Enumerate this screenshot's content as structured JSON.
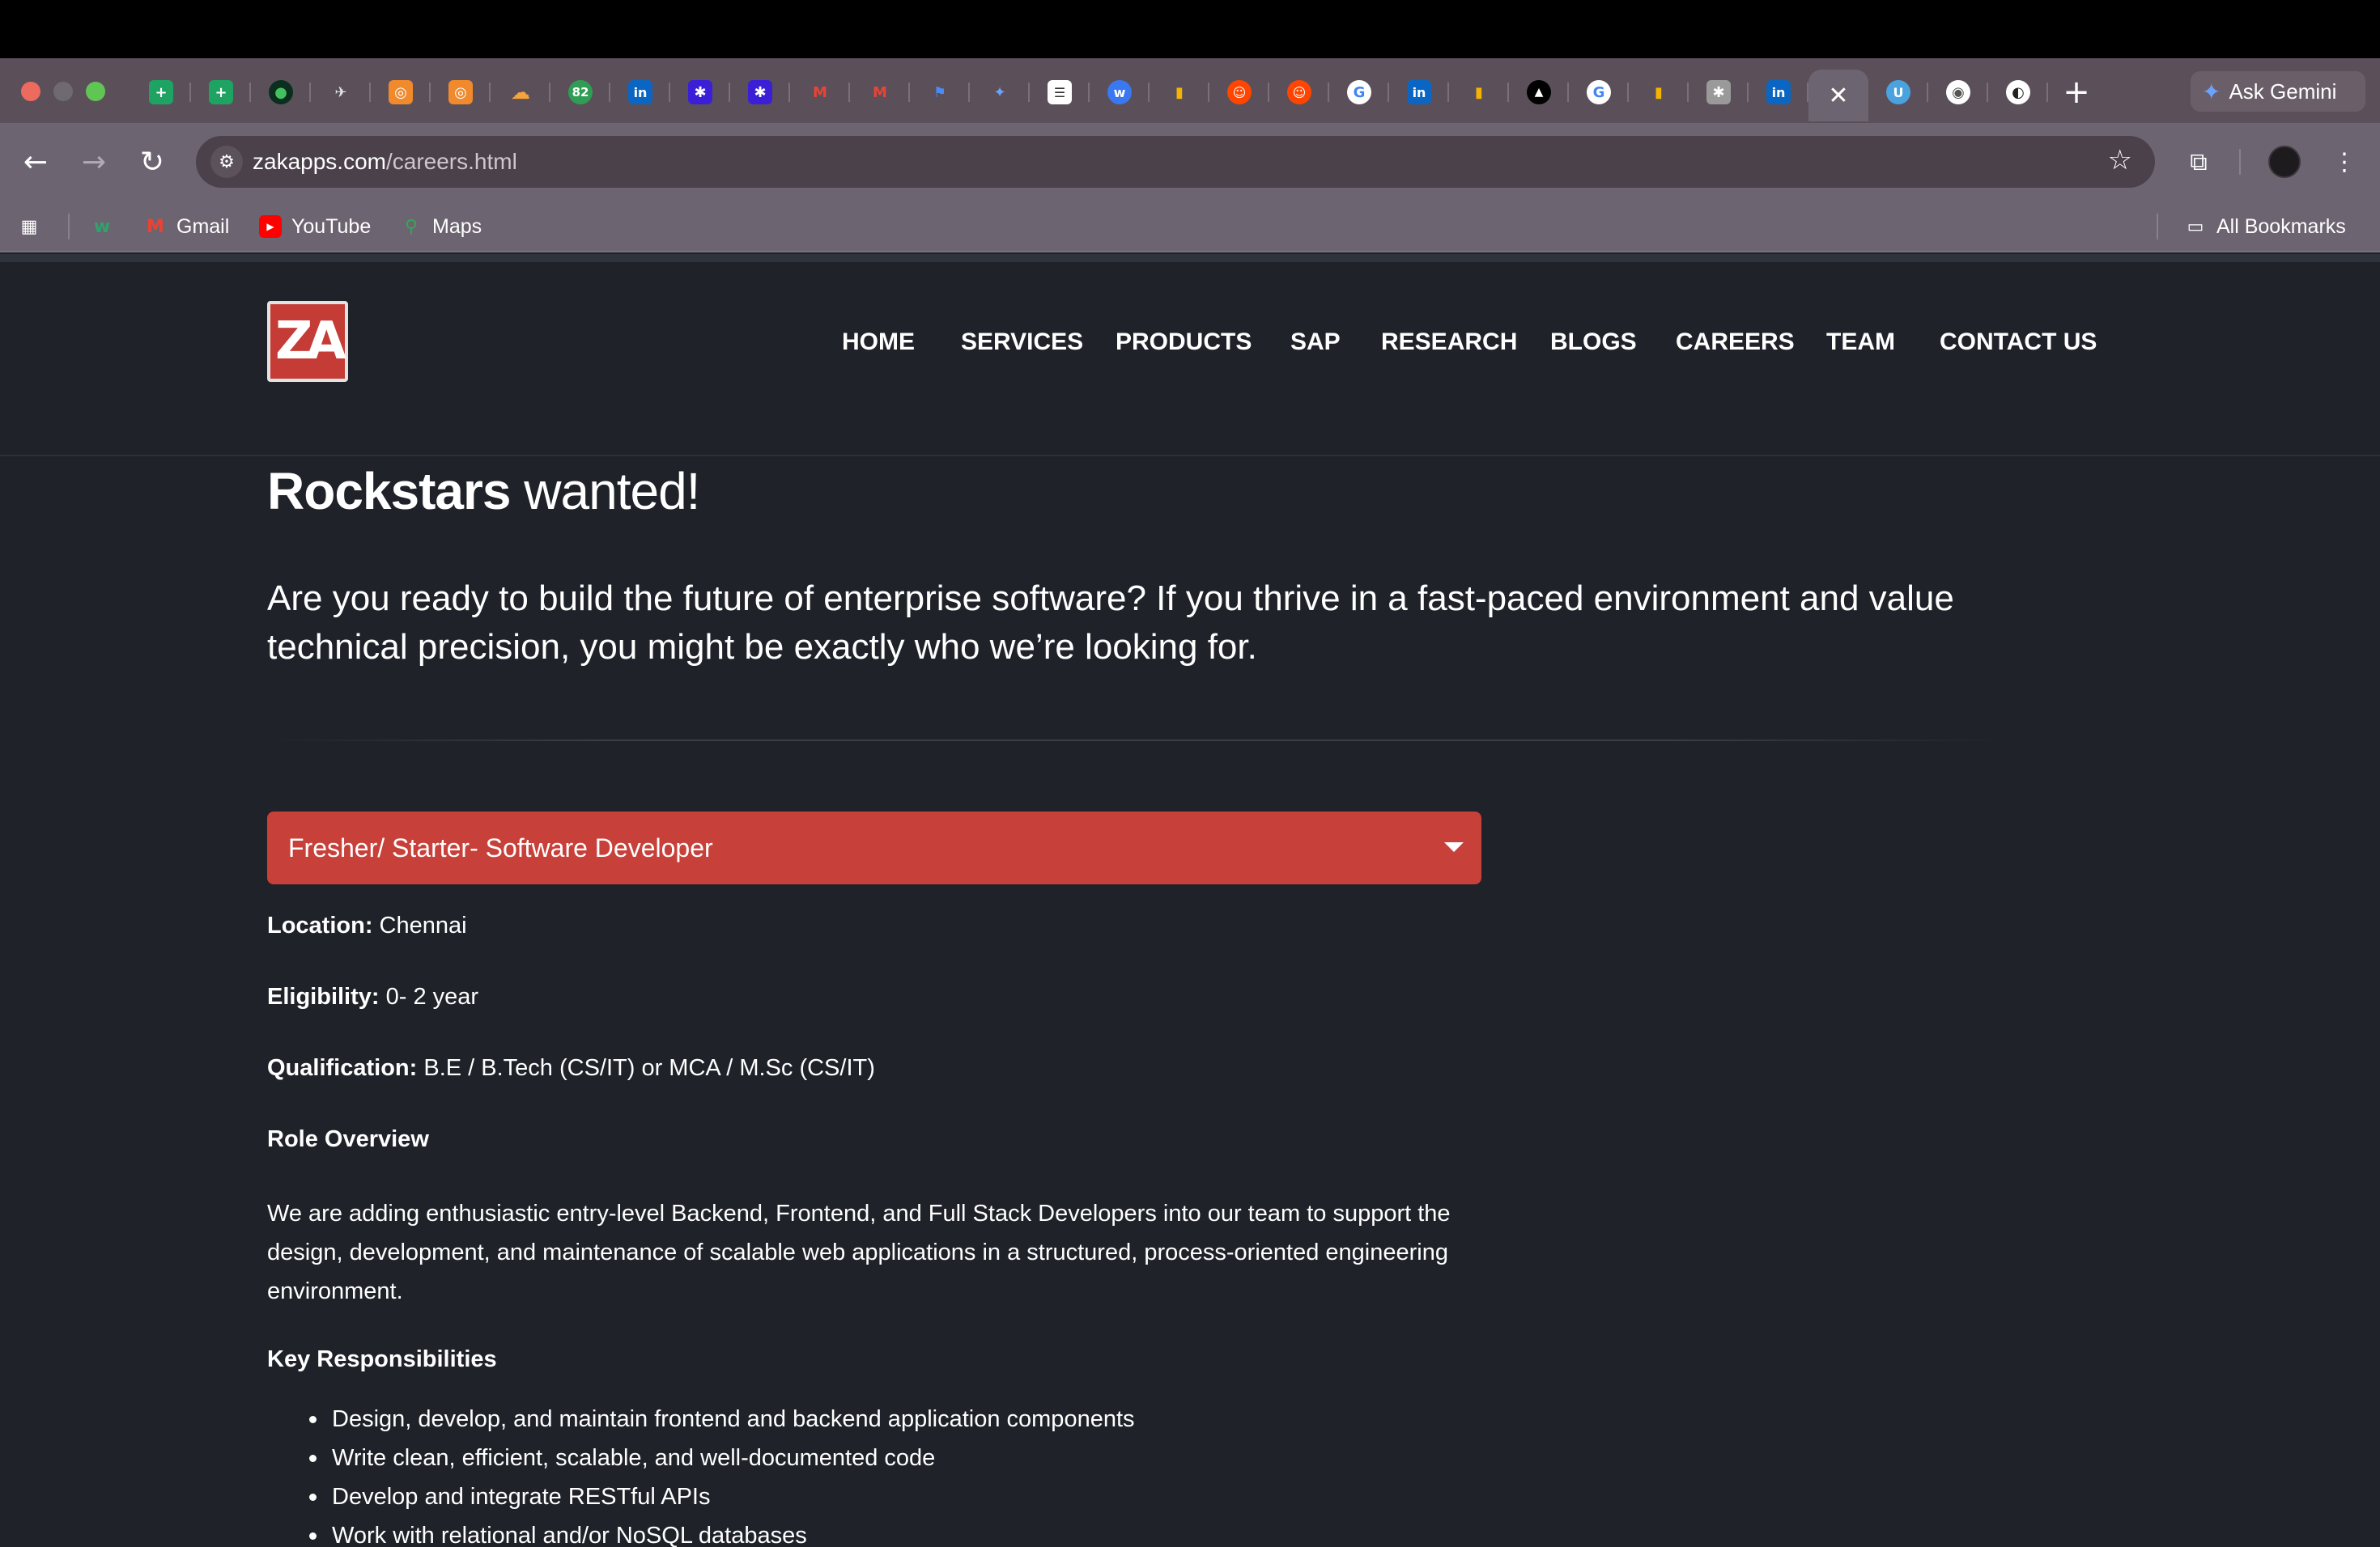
{
  "browser": {
    "tabs_icons": [
      "sheets-icon",
      "sheets-icon",
      "mongodb-icon",
      "bird-icon",
      "orange-app-icon",
      "orange-app-icon",
      "cloudflare-icon",
      "badge-82-icon",
      "linkedin-icon",
      "slack-icon",
      "slack-icon",
      "gmail-icon",
      "gmail-icon",
      "flag-icon",
      "gemini-icon",
      "document-icon",
      "webflow-icon",
      "analytics-icon",
      "reddit-icon",
      "reddit-icon",
      "google-icon",
      "linkedin-icon",
      "analytics-icon",
      "vercel-icon",
      "google-icon",
      "analytics-icon",
      "puzzle-icon",
      "linkedin-icon"
    ],
    "badge_count": "82",
    "ask_gemini": "Ask Gemini",
    "url_host": "zakapps.com",
    "url_path": "/careers.html",
    "bookmarks": {
      "gmail": "Gmail",
      "youtube": "YouTube",
      "maps": "Maps",
      "all": "All Bookmarks"
    }
  },
  "site": {
    "logo_text": "ZA",
    "nav": [
      "HOME",
      "SERVICES",
      "PRODUCTS",
      "SAP",
      "RESEARCH",
      "BLOGS",
      "CAREERS",
      "TEAM",
      "CONTACT US"
    ],
    "headline_bold": "Rockstars",
    "headline_rest": " wanted!",
    "intro": "Are you ready to build the future of enterprise software? If you thrive in a fast-paced environment and value technical precision, you might be exactly who we’re looking for.",
    "job": {
      "selected": "Fresher/ Starter- Software Developer",
      "location_label": "Location:",
      "location": " Chennai",
      "eligibility_label": "Eligibility:",
      "eligibility": " 0- 2 year",
      "qualification_label": "Qualification:",
      "qualification": " B.E / B.Tech (CS/IT) or MCA / M.Sc (CS/IT)",
      "role_overview_title": "Role Overview",
      "role_overview": "We are adding enthusiastic entry-level Backend, Frontend, and Full Stack Developers into our team to support the design, development, and maintenance of scalable web applications in a structured, process-oriented engineering environment.",
      "key_resp_title": "Key Responsibilities",
      "responsibilities": [
        "Design, develop, and maintain frontend and backend application components",
        "Write clean, efficient, scalable, and well-documented code",
        "Develop and integrate RESTful APIs",
        "Work with relational and/or NoSQL databases"
      ]
    }
  },
  "colors": {
    "page_bg": "#1f2229",
    "accent_red": "#c8403a",
    "chrome": "#6c6470",
    "tabstrip": "#5b505a"
  }
}
